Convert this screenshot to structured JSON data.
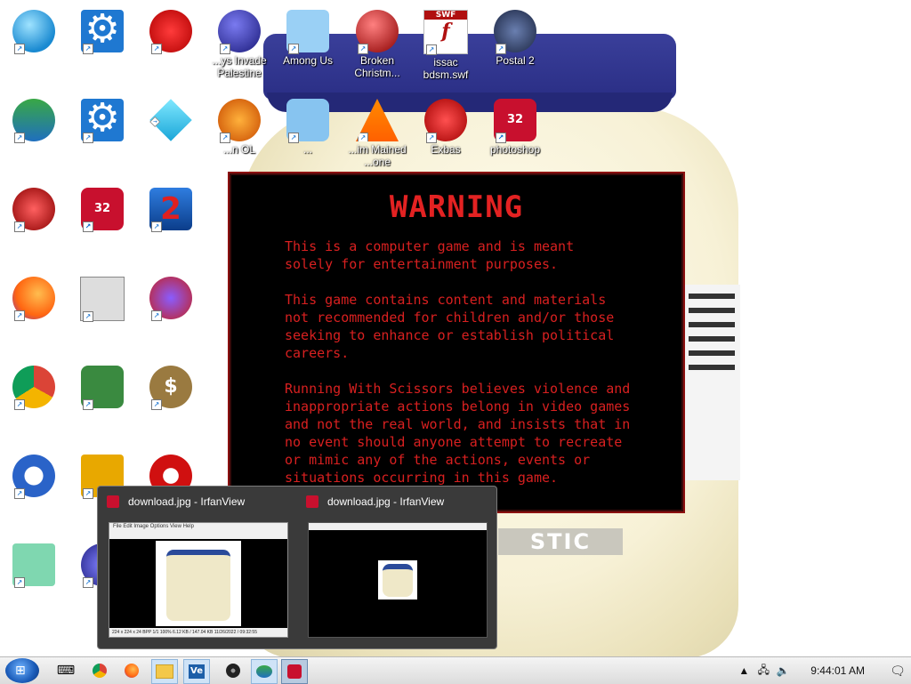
{
  "wallpaper": {
    "jar_label_text": "STIC"
  },
  "desktop_icons": [
    {
      "id": "monitor",
      "label": "",
      "kind": "monitor"
    },
    {
      "id": "settings-1",
      "label": "",
      "kind": "gear"
    },
    {
      "id": "red-fuzzy",
      "label": "",
      "kind": "fuzzy"
    },
    {
      "id": "ornament-palestine",
      "label": "...ys Invade\nPalestine",
      "kind": "ornament-blue"
    },
    {
      "id": "among-us",
      "label": "Among Us",
      "kind": "folder-app"
    },
    {
      "id": "broken-christmas",
      "label": "Broken\nChristm...",
      "kind": "ornament-red"
    },
    {
      "id": "issac-swf",
      "label": "issac\nbdsm.swf",
      "kind": "swf"
    },
    {
      "id": "postal-2",
      "label": "Postal 2",
      "kind": "postal"
    },
    {
      "id": "idm",
      "label": "",
      "kind": "idm"
    },
    {
      "id": "settings-2",
      "label": "",
      "kind": "gear"
    },
    {
      "id": "gem",
      "label": "",
      "kind": "gem"
    },
    {
      "id": "p-icon",
      "label": "...n OL",
      "kind": "p-ball"
    },
    {
      "id": "angry-birds",
      "label": "...",
      "kind": "angry"
    },
    {
      "id": "vlc",
      "label": "...im Mained\n...one",
      "kind": "vlc"
    },
    {
      "id": "exbas",
      "label": "Exbas",
      "kind": "santa"
    },
    {
      "id": "photoshop",
      "label": "photoshop",
      "kind": "puzzle"
    },
    {
      "id": "recycle",
      "label": "",
      "kind": "recycle"
    },
    {
      "id": "puzzle-32",
      "label": "",
      "kind": "puzzle"
    },
    {
      "id": "two",
      "label": "",
      "kind": "two"
    },
    {
      "id": "firefox-desk",
      "label": "",
      "kind": "firefox"
    },
    {
      "id": "sprite",
      "label": "",
      "kind": "sprite"
    },
    {
      "id": "gem-circle",
      "label": "",
      "kind": "gem-circle"
    },
    {
      "id": "chrome-desk",
      "label": "",
      "kind": "chrome"
    },
    {
      "id": "hero",
      "label": "",
      "kind": "hero"
    },
    {
      "id": "money",
      "label": "",
      "kind": "money"
    },
    {
      "id": "obama",
      "label": "",
      "kind": "obama"
    },
    {
      "id": "mahjong",
      "label": "",
      "kind": "mahjong"
    },
    {
      "id": "nuke",
      "label": "",
      "kind": "nuke"
    },
    {
      "id": "notepad",
      "label": "",
      "kind": "notepad"
    },
    {
      "id": "blue-orb",
      "label": "",
      "kind": "blue-orb"
    }
  ],
  "warning": {
    "title": "WARNING",
    "p1": "This is a computer game and is meant\nsolely for entertainment purposes.",
    "p2": "This game contains content and materials\nnot recommended for children and/or those\nseeking to enhance or establish political\ncareers.",
    "p3": "Running With Scissors believes violence and\ninappropriate actions belong in video games\nand not the real world, and insists that in\nno event should anyone attempt to recreate\nor mimic any of the actions, events or\nsituations occurring in this game."
  },
  "previews": [
    {
      "title": "download.jpg - IrfanView",
      "menu": "File  Edit  Image  Options  View  Help",
      "status": "224 x 224 x 24 BPP   1/1   100%   6.12 KB / 147.04 KB   11/26/2022 / 09:32:55"
    },
    {
      "title": "download.jpg - IrfanView",
      "menu": "",
      "status": ""
    }
  ],
  "taskbar": {
    "start_label": "Start",
    "clock": "9:44:01 AM",
    "colors": {
      "bar": "#e6e6e6",
      "accent": "#1a5bb8"
    }
  }
}
